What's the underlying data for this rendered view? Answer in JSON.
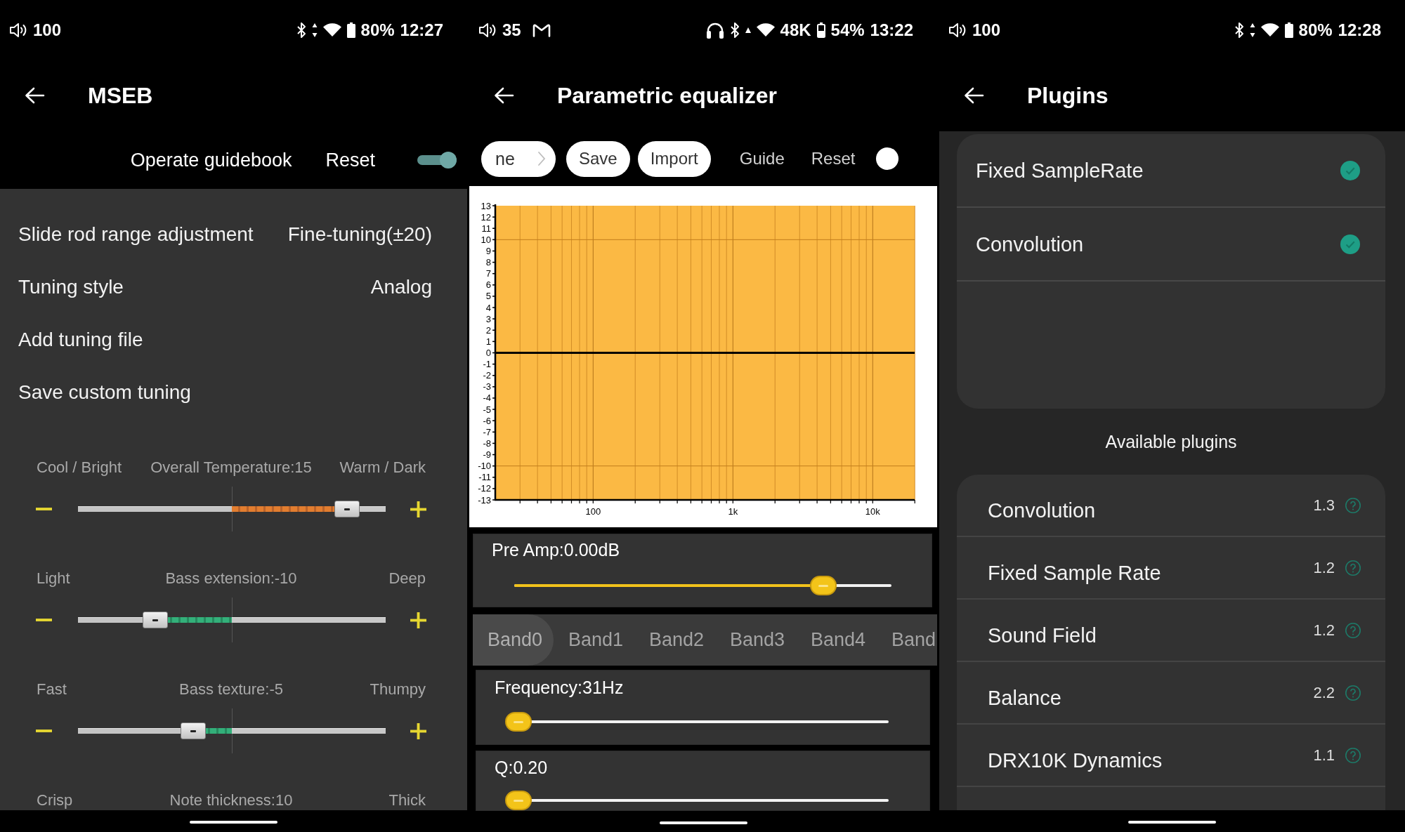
{
  "mseb_screen": {
    "status_bar": {
      "volume": "100",
      "battery": "80%",
      "time": "12:27"
    },
    "app_bar": {
      "title": "MSEB"
    },
    "toolbar": {
      "guide": "Operate guidebook",
      "reset": "Reset",
      "switch": {
        "on": true
      }
    },
    "settings": [
      {
        "label": "Slide rod range adjustment",
        "value": "Fine-tuning(±20)"
      },
      {
        "label": "Tuning style",
        "value": "Analog"
      },
      {
        "label": "Add tuning file"
      },
      {
        "label": "Save custom tuning"
      }
    ],
    "sliders": [
      {
        "left_label": "Cool / Bright",
        "title": "Overall Temperature:15",
        "right_label": "Warm / Dark",
        "level": 0.875
      },
      {
        "left_label": "Light",
        "title": "Bass extension:-10",
        "right_label": "Deep",
        "level": 0.25
      },
      {
        "left_label": "Fast",
        "title": "Bass texture:-5",
        "right_label": "Thumpy",
        "level": 0.375
      },
      {
        "left_label": "Crisp",
        "title": "Note thickness:10",
        "right_label": "Thick"
      }
    ]
  },
  "equalizer_screen": {
    "status_bar": {
      "volume": "35",
      "sample_rate": "48K",
      "battery": "54%",
      "time": "13:22"
    },
    "app_bar": {
      "title": "Parametric equalizer"
    },
    "toolbar": {
      "preset": "ne",
      "buttons": [
        "Save",
        "Import"
      ],
      "links": [
        "Guide",
        "Reset"
      ]
    },
    "response_chart": {
      "chart_data": {
        "type": "line",
        "categories": [
          null,
          null,
          null,
          null,
          null,
          null,
          null,
          "100",
          null,
          null,
          null,
          null,
          null,
          null,
          null,
          null,
          null,
          "1k",
          null,
          null,
          null,
          null,
          null,
          null,
          null,
          null,
          null,
          "10k",
          null,
          null,
          null
        ],
        "series": [
          {
            "color": "#000000",
            "values": [
              0,
              0,
              0,
              0,
              0,
              0,
              0,
              0,
              0,
              0,
              0,
              0,
              0,
              0,
              0,
              0,
              0,
              0,
              0,
              0,
              0,
              0,
              0,
              0,
              0,
              0,
              0,
              0,
              0,
              0,
              0
            ]
          }
        ],
        "ylim": [
          -13,
          13
        ],
        "yticks": [
          -13,
          -12,
          -11,
          -10,
          -9,
          -8,
          -7,
          -6,
          -5,
          -4,
          -3,
          -2,
          -1,
          0,
          1,
          2,
          3,
          4,
          5,
          6,
          7,
          8,
          9,
          10,
          11,
          12,
          13
        ],
        "grid": true
      }
    },
    "pre_amp": {
      "label": "Pre Amp:0.00dB",
      "level": 0.82
    },
    "band_tabs": [
      {
        "label": "Band0",
        "selected": true
      },
      {
        "label": "Band1",
        "selected": false
      },
      {
        "label": "Band2",
        "selected": false
      },
      {
        "label": "Band3",
        "selected": false
      },
      {
        "label": "Band4",
        "selected": false
      },
      {
        "label": "Band",
        "selected": false
      }
    ],
    "band_sliders": [
      {
        "label": "Frequency:31Hz",
        "level": 0
      },
      {
        "label": "Q:0.20",
        "level": 0
      }
    ]
  },
  "plugins_screen": {
    "status_bar": {
      "volume": "100",
      "battery": "80%",
      "time": "12:28"
    },
    "app_bar": {
      "title": "Plugins"
    },
    "active_plugins": [
      {
        "name": "Fixed SampleRate",
        "checked": true
      },
      {
        "name": "Convolution",
        "checked": true
      }
    ],
    "available_heading": "Available plugins",
    "available_plugins": [
      {
        "name": "Convolution",
        "version": "1.3"
      },
      {
        "name": "Fixed Sample Rate",
        "version": "1.2"
      },
      {
        "name": "Sound Field",
        "version": "1.2"
      },
      {
        "name": "Balance",
        "version": "2.2"
      },
      {
        "name": "DRX10K Dynamics",
        "version": "1.1"
      }
    ]
  }
}
